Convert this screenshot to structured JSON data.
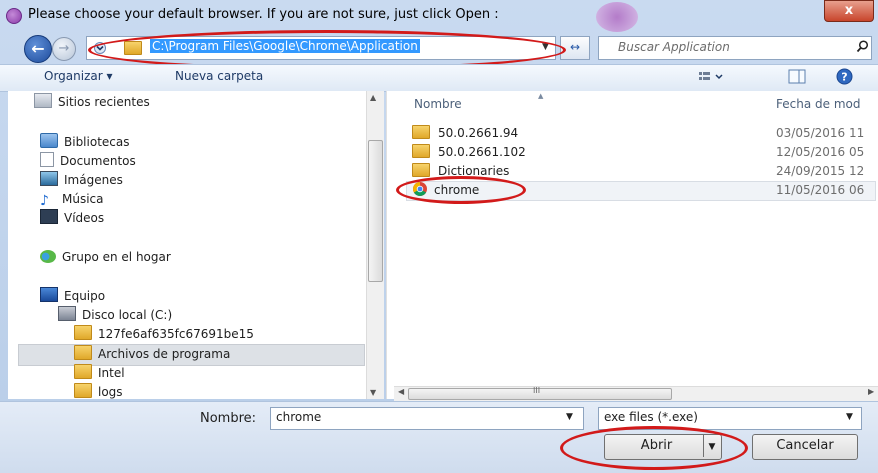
{
  "window": {
    "title": "Please choose your default browser. If you are not sure, just click Open :",
    "close_glyph": "x"
  },
  "nav": {
    "back_glyph": "←",
    "forward_glyph": "→",
    "address": "C:\\Program Files\\Google\\Chrome\\Application",
    "refresh_glyph": "↔",
    "search_placeholder": "Buscar Application"
  },
  "toolbar": {
    "organize": "Organizar ▾",
    "new_folder": "Nueva carpeta"
  },
  "sidebar": {
    "items": [
      {
        "label": "Sitios recientes",
        "icon": "recent-places-icon"
      },
      {
        "label": "Bibliotecas",
        "icon": "libraries-icon"
      },
      {
        "label": "Documentos",
        "icon": "documents-icon"
      },
      {
        "label": "Imágenes",
        "icon": "pictures-icon"
      },
      {
        "label": "Música",
        "icon": "music-icon"
      },
      {
        "label": "Vídeos",
        "icon": "videos-icon"
      },
      {
        "label": "Grupo en el hogar",
        "icon": "homegroup-icon"
      },
      {
        "label": "Equipo",
        "icon": "computer-icon"
      },
      {
        "label": "Disco local (C:)",
        "icon": "drive-icon"
      },
      {
        "label": "127fe6af635fc67691be15",
        "icon": "folder-icon"
      },
      {
        "label": "Archivos de programa",
        "icon": "folder-icon"
      },
      {
        "label": "Intel",
        "icon": "folder-icon"
      },
      {
        "label": "logs",
        "icon": "folder-icon"
      }
    ]
  },
  "files": {
    "col_name": "Nombre",
    "col_date": "Fecha de mod",
    "rows": [
      {
        "name": "50.0.2661.94",
        "date": "03/05/2016 11",
        "icon": "folder-icon"
      },
      {
        "name": "50.0.2661.102",
        "date": "12/05/2016 05",
        "icon": "folder-icon"
      },
      {
        "name": "Dictionaries",
        "date": "24/09/2015 12",
        "icon": "folder-icon"
      },
      {
        "name": "chrome",
        "date": "11/05/2016 06",
        "icon": "chrome-icon"
      }
    ],
    "scroll_grip": "III"
  },
  "footer": {
    "name_label": "Nombre:",
    "name_value": "chrome",
    "file_type": "exe files (*.exe)",
    "open_button": "Abrir",
    "cancel_button": "Cancelar"
  },
  "colors": {
    "highlight": "#3399ff",
    "annotation_red": "#d21a1a"
  }
}
